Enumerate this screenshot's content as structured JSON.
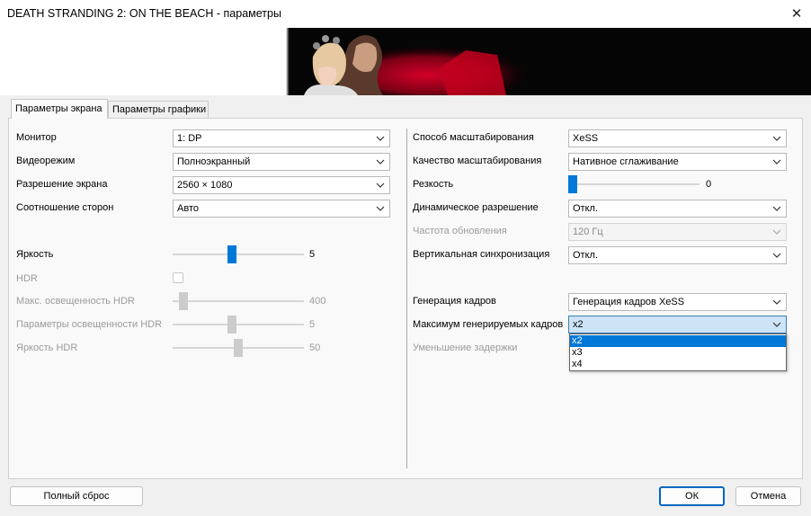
{
  "window": {
    "title": "DEATH STRANDING 2: ON THE BEACH - параметры",
    "close_glyph": "✕"
  },
  "tabs": [
    {
      "label": "Параметры экрана",
      "active": true
    },
    {
      "label": "Параметры графики",
      "active": false
    }
  ],
  "left": {
    "monitor": {
      "label": "Монитор",
      "value": "1: DP"
    },
    "video_mode": {
      "label": "Видеорежим",
      "value": "Полноэкранный"
    },
    "resolution": {
      "label": "Разрешение экрана",
      "value": "2560 × 1080"
    },
    "aspect": {
      "label": "Соотношение сторон",
      "value": "Авто"
    },
    "brightness": {
      "label": "Яркость",
      "value": "5",
      "fraction": 0.45
    },
    "hdr": {
      "label": "HDR",
      "checked": false
    },
    "hdr_max": {
      "label": "Макс. освещенность HDR",
      "value": "400",
      "fraction": 0.05
    },
    "hdr_params": {
      "label": "Параметры освещенности HDR",
      "value": "5",
      "fraction": 0.45
    },
    "hdr_brightness": {
      "label": "Яркость HDR",
      "value": "50",
      "fraction": 0.5
    }
  },
  "right": {
    "upscale_method": {
      "label": "Способ масштабирования",
      "value": "XeSS"
    },
    "upscale_quality": {
      "label": "Качество масштабирования",
      "value": "Нативное сглаживание"
    },
    "sharpness": {
      "label": "Резкость",
      "value": "0",
      "fraction": 0.0
    },
    "dynamic_res": {
      "label": "Динамическое разрешение",
      "value": "Откл."
    },
    "refresh_rate": {
      "label": "Частота обновления",
      "value": "120 Гц"
    },
    "vsync": {
      "label": "Вертикальная синхронизация",
      "value": "Откл."
    },
    "frame_gen": {
      "label": "Генерация кадров",
      "value": "Генерация кадров XeSS"
    },
    "max_frames": {
      "label": "Максимум генерируемых кадров",
      "value": "x2",
      "options": [
        "x2",
        "x3",
        "x4"
      ],
      "selected_index": 0
    },
    "latency": {
      "label": "Уменьшение задержки"
    }
  },
  "footer": {
    "reset_label": "Полный сброс",
    "ok_label": "ОК",
    "cancel_label": "Отмена"
  },
  "colors": {
    "accent": "#0078d7",
    "banner_red": "#b5001f",
    "disabled_text": "#9b9b9b"
  }
}
